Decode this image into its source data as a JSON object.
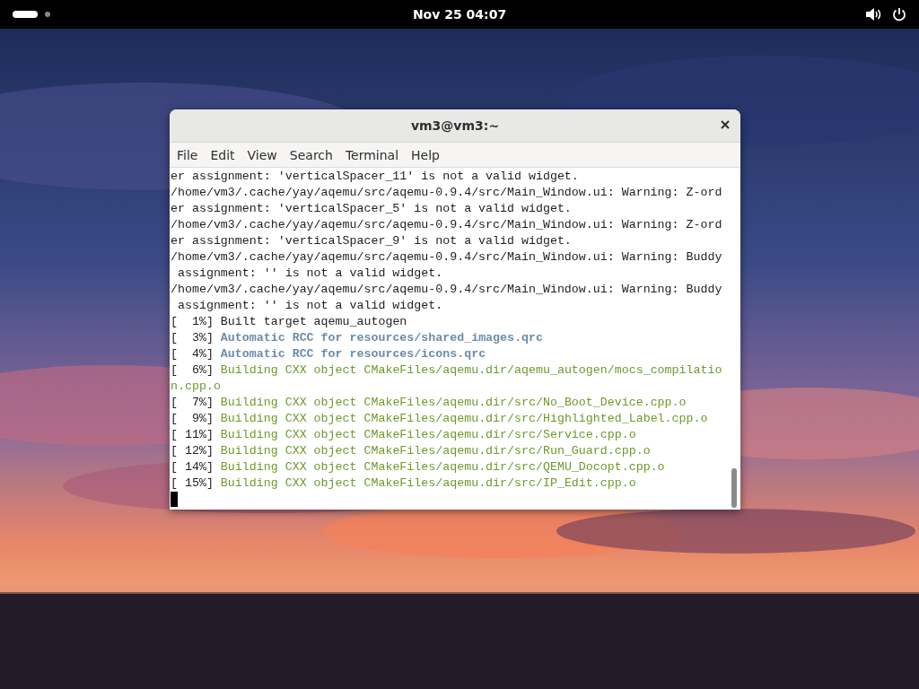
{
  "top_bar": {
    "clock": "Nov 25  04:07"
  },
  "window": {
    "title": "vm3@vm3:~",
    "menu": [
      {
        "label": "File"
      },
      {
        "label": "Edit"
      },
      {
        "label": "View"
      },
      {
        "label": "Search"
      },
      {
        "label": "Terminal"
      },
      {
        "label": "Help"
      }
    ],
    "terminal_lines": [
      {
        "kind": "output",
        "text": "er assignment: 'verticalSpacer_11' is not a valid widget."
      },
      {
        "kind": "output",
        "text": "/home/vm3/.cache/yay/aqemu/src/aqemu-0.9.4/src/Main_Window.ui: Warning: Z-ord"
      },
      {
        "kind": "output",
        "text": "er assignment: 'verticalSpacer_5' is not a valid widget."
      },
      {
        "kind": "output",
        "text": "/home/vm3/.cache/yay/aqemu/src/aqemu-0.9.4/src/Main_Window.ui: Warning: Z-ord"
      },
      {
        "kind": "output",
        "text": "er assignment: 'verticalSpacer_9' is not a valid widget."
      },
      {
        "kind": "output",
        "text": "/home/vm3/.cache/yay/aqemu/src/aqemu-0.9.4/src/Main_Window.ui: Warning: Buddy"
      },
      {
        "kind": "output",
        "text": " assignment: '' is not a valid widget."
      },
      {
        "kind": "output",
        "text": "/home/vm3/.cache/yay/aqemu/src/aqemu-0.9.4/src/Main_Window.ui: Warning: Buddy"
      },
      {
        "kind": "output",
        "text": " assignment: '' is not a valid widget."
      },
      {
        "kind": "output",
        "prefix": "[  1%]",
        "text": " Built target aqemu_autogen"
      },
      {
        "kind": "rcc",
        "prefix": "[  3%]",
        "text": " Automatic RCC for resources/shared_images.qrc"
      },
      {
        "kind": "rcc",
        "prefix": "[  4%]",
        "text": " Automatic RCC for resources/icons.qrc"
      },
      {
        "kind": "build",
        "prefix": "[  6%]",
        "text": " Building CXX object CMakeFiles/aqemu.dir/aqemu_autogen/mocs_compilatio"
      },
      {
        "kind": "build",
        "text": "n.cpp.o"
      },
      {
        "kind": "build",
        "prefix": "[  7%]",
        "text": " Building CXX object CMakeFiles/aqemu.dir/src/No_Boot_Device.cpp.o"
      },
      {
        "kind": "build",
        "prefix": "[  9%]",
        "text": " Building CXX object CMakeFiles/aqemu.dir/src/Highlighted_Label.cpp.o"
      },
      {
        "kind": "build",
        "prefix": "[ 11%]",
        "text": " Building CXX object CMakeFiles/aqemu.dir/src/Service.cpp.o"
      },
      {
        "kind": "build",
        "prefix": "[ 12%]",
        "text": " Building CXX object CMakeFiles/aqemu.dir/src/Run_Guard.cpp.o"
      },
      {
        "kind": "build",
        "prefix": "[ 14%]",
        "text": " Building CXX object CMakeFiles/aqemu.dir/src/QEMU_Docopt.cpp.o"
      },
      {
        "kind": "build",
        "prefix": "[ 15%]",
        "text": " Building CXX object CMakeFiles/aqemu.dir/src/IP_Edit.cpp.o"
      }
    ]
  }
}
